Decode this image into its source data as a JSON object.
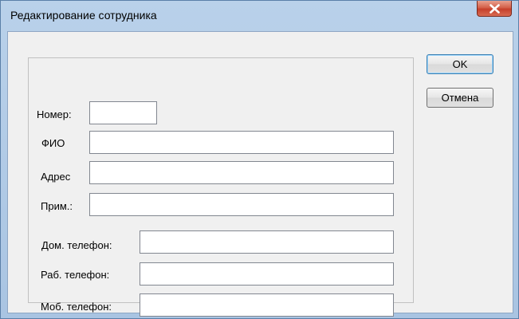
{
  "window": {
    "title": "Редактирование сотрудника"
  },
  "form": {
    "number_label": "Номер:",
    "number_value": "",
    "fio_label": "ФИО",
    "fio_value": "",
    "address_label": "Адрес",
    "address_value": "",
    "note_label": "Прим.:",
    "note_value": "",
    "home_phone_label": "Дом. телефон:",
    "home_phone_value": "",
    "work_phone_label": "Раб. телефон:",
    "work_phone_value": "",
    "mobile_phone_label": "Моб. телефон:",
    "mobile_phone_value": ""
  },
  "buttons": {
    "ok": "OK",
    "cancel": "Отмена"
  },
  "icons": {
    "close": "close-icon"
  },
  "colors": {
    "titlebar": "#b9d1ea",
    "close_button": "#c6402b",
    "client": "#f0f0f0"
  }
}
